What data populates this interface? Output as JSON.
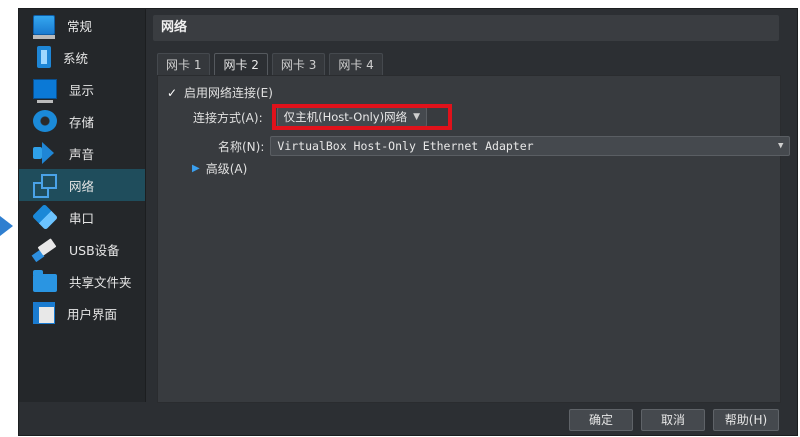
{
  "sidebar": {
    "items": [
      {
        "label": "常规",
        "icon": "general-settings-icon"
      },
      {
        "label": "系统",
        "icon": "system-chip-icon"
      },
      {
        "label": "显示",
        "icon": "display-monitor-icon"
      },
      {
        "label": "存储",
        "icon": "storage-disk-icon"
      },
      {
        "label": "声音",
        "icon": "audio-speaker-icon"
      },
      {
        "label": "网络",
        "icon": "network-icon"
      },
      {
        "label": "串口",
        "icon": "serial-port-icon"
      },
      {
        "label": "USB设备",
        "icon": "usb-icon"
      },
      {
        "label": "共享文件夹",
        "icon": "shared-folder-icon"
      },
      {
        "label": "用户界面",
        "icon": "user-interface-icon"
      }
    ],
    "selected_index": 5
  },
  "content": {
    "title": "网络",
    "tabs": [
      "网卡 1",
      "网卡 2",
      "网卡 3",
      "网卡 4"
    ],
    "active_tab_index": 1,
    "enable_label": "启用网络连接(E)",
    "enable_checked": "✓",
    "attach_label": "连接方式(A):",
    "attach_value": "仅主机(Host-Only)网络",
    "name_label": "名称(N):",
    "name_value": "VirtualBox Host-Only Ethernet Adapter",
    "advanced_label": "高级(A)"
  },
  "footer": {
    "ok": "确定",
    "cancel": "取消",
    "help": "帮助(H)"
  },
  "colors": {
    "selected_bg": "#1f4d5c",
    "highlight": "#e0121b",
    "arrow": "#2f7fd0"
  }
}
